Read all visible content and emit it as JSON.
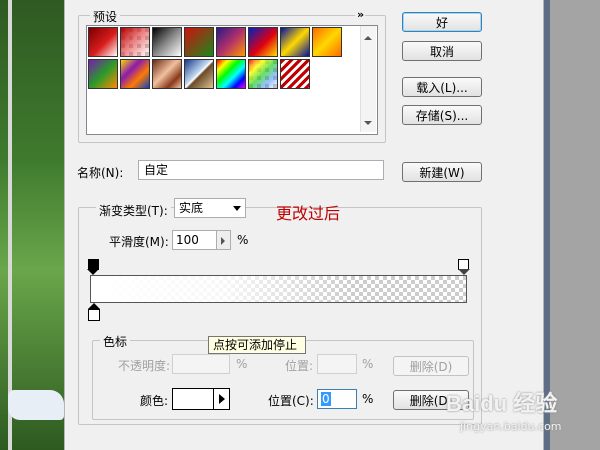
{
  "presets": {
    "title": "预设",
    "menu_icon": "double-chevron-right-icon",
    "swatches": [
      {
        "name": "fg-to-bg",
        "css": "linear-gradient(135deg,#7a0000 0%,#d81c1c 55%,#fff 100%)"
      },
      {
        "name": "fg-to-transparent",
        "css": "checker-red"
      },
      {
        "name": "black-white",
        "css": "linear-gradient(135deg,#000 0%,#888 50%,#fff 100%)"
      },
      {
        "name": "red-green",
        "css": "linear-gradient(135deg,#d01010 0%,#1a8a1a 100%)"
      },
      {
        "name": "violet-orange",
        "css": "linear-gradient(135deg,#2a1a8a 0%,#b0306a 50%,#ff9a00 100%)"
      },
      {
        "name": "blue-red-yellow",
        "css": "linear-gradient(135deg,#0020c0 0%,#e00010 55%,#ffe000 100%)"
      },
      {
        "name": "blue-yellow-blue",
        "css": "linear-gradient(135deg,#0010a0 0%,#ffd800 50%,#0010a0 100%)"
      },
      {
        "name": "orange-yellow-orange",
        "css": "linear-gradient(135deg,#ff6a00 0%,#ffd800 50%,#ff6a00 100%)"
      },
      {
        "name": "violet-green-orange",
        "css": "linear-gradient(135deg,#7a1ab0 0%,#2a9a2a 50%,#ff8a00 100%)"
      },
      {
        "name": "yellow-violet-orange-blue",
        "css": "linear-gradient(135deg,#ffd800 0%,#8a1ab0 35%,#ff7a00 65%,#1040c0 100%)"
      },
      {
        "name": "copper",
        "css": "linear-gradient(135deg,#6a2a10 0%,#f0c0a0 45%,#8a3a1a 75%,#f0c0a0 100%)"
      },
      {
        "name": "chrome",
        "css": "linear-gradient(135deg,#1a3a8a 0%,#c0d8f0 45%,#fff 50%,#6a4a2a 55%,#e0c090 100%)"
      },
      {
        "name": "spectrum",
        "css": "linear-gradient(135deg,#f00 0%,#ff0 20%,#0f0 40%,#0ff 60%,#00f 80%,#f0f 100%)"
      },
      {
        "name": "transparent-rainbow",
        "css": "checker-rainbow"
      },
      {
        "name": "transparent-stripes",
        "css": "repeating-linear-gradient(135deg,#c00000 0px,#c00000 3px,#fff 3px,#fff 6px)"
      }
    ]
  },
  "buttons": {
    "ok": "好",
    "cancel": "取消",
    "load": "载入(L)...",
    "save": "存储(S)...",
    "new": "新建(W)",
    "delete_opacity": "删除(D)",
    "delete_color": "删除(D)"
  },
  "name": {
    "label": "名称(N):",
    "value": "自定"
  },
  "gradient_type": {
    "label": "渐变类型(T):",
    "value": "实底"
  },
  "annotation": "更改过后",
  "smoothness": {
    "label": "平滑度(M):",
    "value": "100",
    "unit": "%"
  },
  "stops": {
    "title": "色标",
    "opacity_label": "不透明度:",
    "opacity_value": "",
    "opacity_unit": "%",
    "opacity_position_label": "位置:",
    "opacity_position_value": "",
    "opacity_position_unit": "%",
    "color_label": "颜色:",
    "color_value": "#ffffff",
    "color_position_label": "位置(C):",
    "color_position_value": "0",
    "color_position_unit": "%"
  },
  "tooltip": "点按可添加停止",
  "watermark": {
    "logo": "Baidu 经验",
    "url": "jingyan.baidu.com"
  },
  "colors": {
    "annotation": "#c00000",
    "dialog_bg": "#f0f0f0",
    "gradient_start": "#ffffff"
  }
}
